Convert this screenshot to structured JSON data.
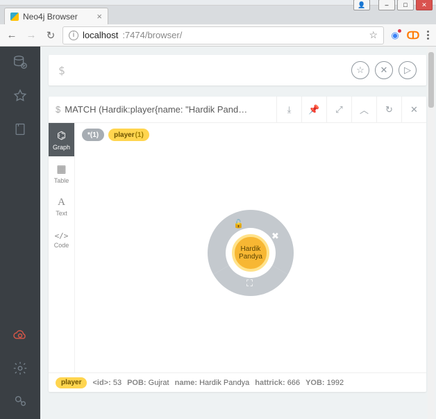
{
  "window": {
    "minimize": "–",
    "maximize": "□",
    "close": "✕",
    "user": "👤"
  },
  "tab": {
    "title": "Neo4j Browser",
    "close": "×"
  },
  "address": {
    "back": "←",
    "forward": "→",
    "reload": "↻",
    "host": "localhost",
    "port_path": ":7474/browser/",
    "star": "☆",
    "ext_orange": "ↀ",
    "info": "i"
  },
  "editor": {
    "prompt": "$",
    "fav": "☆",
    "clear": "✕",
    "run": "▷"
  },
  "result": {
    "prompt": "$",
    "query": "MATCH (Hardik:player{name: \"Hardik Pand…",
    "tools": {
      "download": "⤓",
      "pin": "📌",
      "expand": "⤢",
      "collapse": "︿",
      "rerun": "↻",
      "close": "✕"
    },
    "views": {
      "graph": {
        "label": "Graph",
        "icon": "⌬"
      },
      "table": {
        "label": "Table",
        "icon": "▦"
      },
      "text": {
        "label": "Text",
        "icon": "A"
      },
      "code": {
        "label": "Code",
        "icon": "</>"
      }
    },
    "chips": {
      "all": "*(1)",
      "player_label": "player",
      "player_count": "(1)"
    },
    "node": {
      "line1": "Hardik",
      "line2": "Pandya"
    },
    "ring_icons": {
      "unlock": "🔓",
      "remove": "✖",
      "expand": "⛶"
    },
    "details": {
      "label": "player",
      "id_key": "<id>:",
      "id_val": "53",
      "pob_key": "POB:",
      "pob_val": "Gujrat",
      "name_key": "name:",
      "name_val": "Hardik Pandya",
      "hat_key": "hattrick:",
      "hat_val": "666",
      "yob_key": "YOB:",
      "yob_val": "1992"
    }
  }
}
